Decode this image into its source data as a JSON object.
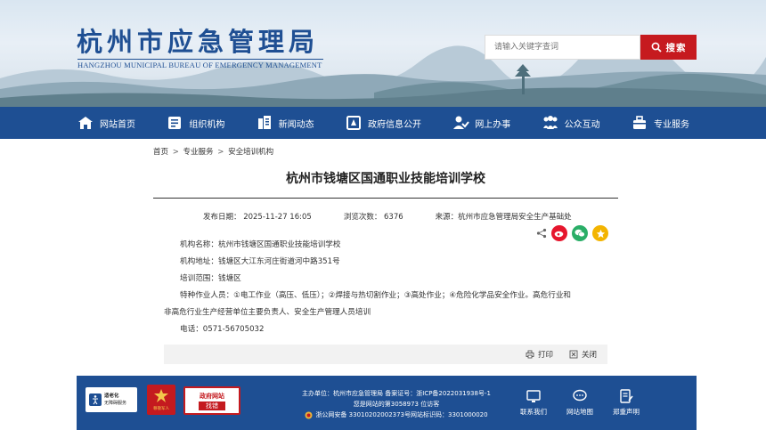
{
  "header": {
    "title": "杭州市应急管理局",
    "subtitle": "HANGZHOU MUNICIPAL BUREAU OF EMERGENCY MANAGEMENT",
    "search_placeholder": "请输入关键字查词",
    "search_label": "搜索"
  },
  "nav": {
    "items": [
      {
        "label": "网站首页",
        "icon": "home-icon"
      },
      {
        "label": "组织机构",
        "icon": "org-icon"
      },
      {
        "label": "新闻动态",
        "icon": "news-icon"
      },
      {
        "label": "政府信息公开",
        "icon": "gov-info-icon"
      },
      {
        "label": "网上办事",
        "icon": "online-service-icon"
      },
      {
        "label": "公众互动",
        "icon": "interaction-icon"
      },
      {
        "label": "专业服务",
        "icon": "professional-service-icon"
      }
    ]
  },
  "breadcrumb": [
    "首页",
    "专业服务",
    "安全培训机构"
  ],
  "breadcrumb_sep": ">",
  "article": {
    "title": "杭州市钱塘区国通职业技能培训学校",
    "publish_date": "发布日期： 2025-11-27 16:05",
    "views": "浏览次数： 6376",
    "source": "来源：杭州市应急管理局安全生产基础处",
    "lines": [
      "机构名称：杭州市钱塘区国通职业技能培训学校",
      "机构地址：钱塘区大江东河庄街道河中路351号",
      "培训范围：钱塘区",
      "特种作业人员：①电工作业（高压、低压）；②焊接与热切割作业；③高处作业；④危险化学品安全作业。高危行业和",
      "非高危行业生产经营单位主要负责人、安全生产管理人员培训",
      "电话：0571-56705032"
    ],
    "print_label": "打印",
    "close_label": "关闭"
  },
  "footer": {
    "badge_a_line1": "适老化",
    "badge_a_line2": "无障碍服务",
    "badge_b": "尊敬军人",
    "badge_c_line1": "政府网站",
    "badge_c_line2": "找错",
    "line1": "主办单位：杭州市应急管理局  备案证号：浙ICP备2022031938号-1",
    "line2": "您是网站的第3058973 位访客",
    "line3": "浙公网安备 33010202002373号网站标识码：3301000020",
    "links": [
      "联系我们",
      "网站地图",
      "郑重声明"
    ]
  },
  "colors": {
    "brand_blue": "#1e4f93",
    "search_red": "#c61a1f"
  }
}
